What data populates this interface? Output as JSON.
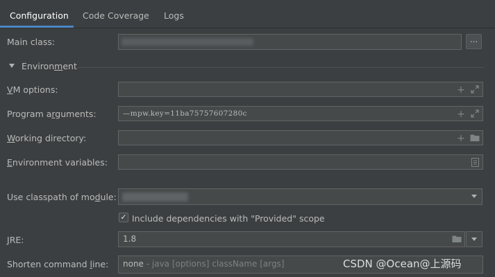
{
  "tabs": [
    {
      "label": "Configuration",
      "active": true
    },
    {
      "label": "Code Coverage",
      "active": false
    },
    {
      "label": "Logs",
      "active": false
    }
  ],
  "main_class": {
    "label": "Main class:",
    "value": "",
    "browse_label": "..."
  },
  "environment_section": {
    "label": "Environment",
    "underline_char": "m"
  },
  "vm_options": {
    "label_pre": "",
    "label_u": "V",
    "label_post": "M options:",
    "value": ""
  },
  "program_arguments": {
    "label_pre": "Program a",
    "label_u": "r",
    "label_post": "guments:",
    "value": "—mpw.key=11ba75757607280c"
  },
  "working_directory": {
    "label_pre": "",
    "label_u": "W",
    "label_post": "orking directory:",
    "value": ""
  },
  "environment_variables": {
    "label_pre": "",
    "label_u": "E",
    "label_post": "nvironment variables:",
    "value": ""
  },
  "classpath_module": {
    "label_pre": "Use classpath of mo",
    "label_u": "d",
    "label_post": "ule:",
    "value": ""
  },
  "include_dependencies": {
    "label": "Include dependencies with \"Provided\" scope",
    "checked": true
  },
  "jre": {
    "label_pre": "",
    "label_u": "J",
    "label_post": "RE:",
    "value": "1.8"
  },
  "shorten_command_line": {
    "label_pre": "Shorten command ",
    "label_u": "l",
    "label_post": "ine:",
    "value": "none",
    "hint": " - java [options] className [args]"
  },
  "watermark": "CSDN @Ocean@上源码",
  "colors": {
    "accent": "#4a88c7",
    "background": "#3c3f41",
    "field": "#45494a",
    "border": "#646464"
  }
}
